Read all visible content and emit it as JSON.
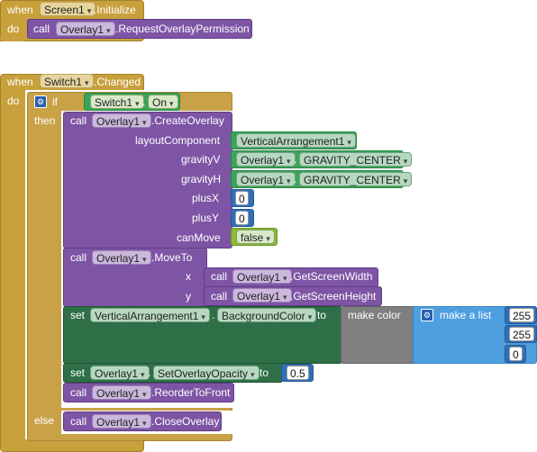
{
  "screen_init": {
    "when": "when",
    "component": "Screen1",
    "event": ".Initialize",
    "do": "do",
    "call": "call",
    "target": "Overlay1",
    "method": ".RequestOverlayPermission"
  },
  "switch_changed": {
    "when": "when",
    "component": "Switch1",
    "event": ".Changed",
    "do": "do",
    "if": "if",
    "then": "then",
    "else": "else",
    "cond_component": "Switch1",
    "cond_dot": ".",
    "cond_prop": "On",
    "create": {
      "call": "call",
      "target": "Overlay1",
      "method": ".CreateOverlay",
      "params": [
        "layoutComponent",
        "gravityV",
        "gravityH",
        "plusX",
        "plusY",
        "canMove"
      ],
      "layout_value": "VerticalArrangement1",
      "gravityV_comp": "Overlay1",
      "gravityV_dot": ".",
      "gravityV_val": "GRAVITY_CENTER",
      "gravityH_comp": "Overlay1",
      "gravityH_dot": ".",
      "gravityH_val": "GRAVITY_CENTER",
      "plusX": "0",
      "plusY": "0",
      "canMove": "false"
    },
    "move": {
      "call": "call",
      "target": "Overlay1",
      "method": ".MoveTo",
      "x_label": "x",
      "y_label": "y",
      "x_call": "call",
      "x_comp": "Overlay1",
      "x_method": ".GetScreenWidth",
      "y_call": "call",
      "y_comp": "Overlay1",
      "y_method": ".GetScreenHeight"
    },
    "bgcolor": {
      "set": "set",
      "component": "VerticalArrangement1",
      "dot": ".",
      "prop": "BackgroundColor",
      "to": "to",
      "make_color": "make color",
      "make_list": "make a list",
      "values": [
        "255",
        "255",
        "0"
      ]
    },
    "opacity": {
      "set": "set",
      "component": "Overlay1",
      "dot": ".",
      "prop": "SetOverlayOpacity",
      "to": "to",
      "value": "0.5"
    },
    "reorder": {
      "call": "call",
      "target": "Overlay1",
      "method": ".ReorderToFront"
    },
    "close": {
      "call": "call",
      "target": "Overlay1",
      "method": ".CloseOverlay"
    }
  }
}
